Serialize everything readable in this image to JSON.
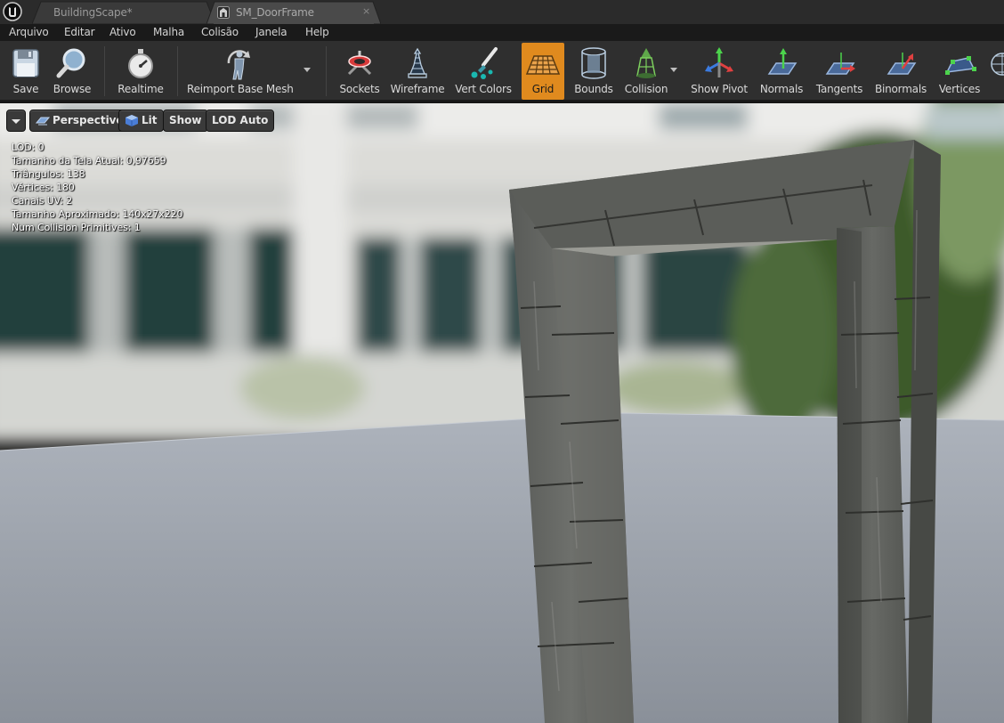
{
  "tabs": [
    {
      "label": "BuildingScape*",
      "active": false
    },
    {
      "label": "SM_DoorFrame",
      "active": true,
      "icon": "static-mesh-icon",
      "close": "×"
    }
  ],
  "menu": [
    "Arquivo",
    "Editar",
    "Ativo",
    "Malha",
    "Colisão",
    "Janela",
    "Help"
  ],
  "toolbar": {
    "save": "Save",
    "browse": "Browse",
    "realtime": "Realtime",
    "reimport": "Reimport Base Mesh",
    "sockets": "Sockets",
    "wireframe": "Wireframe",
    "vert_colors": "Vert Colors",
    "grid": "Grid",
    "bounds": "Bounds",
    "collision": "Collision",
    "show_pivot": "Show Pivot",
    "normals": "Normals",
    "tangents": "Tangents",
    "binormals": "Binormals",
    "vertices": "Vertices",
    "active_toggle": "Grid",
    "accent_color": "#e08a1e"
  },
  "viewport": {
    "perspective": "Perspective",
    "lit": "Lit",
    "show": "Show",
    "lod": "LOD Auto",
    "stats": {
      "lod": "LOD: 0",
      "screen_size": "Tamanho da Tela Atual: 0,97659",
      "triangles": "Triângulos: 138",
      "vertices": "Vértices: 180",
      "uv_channels": "Canais UV: 2",
      "approx_size": "Tamanho Aproximado: 140x27x220",
      "collision": "Num Collision Primitives:  1"
    }
  }
}
